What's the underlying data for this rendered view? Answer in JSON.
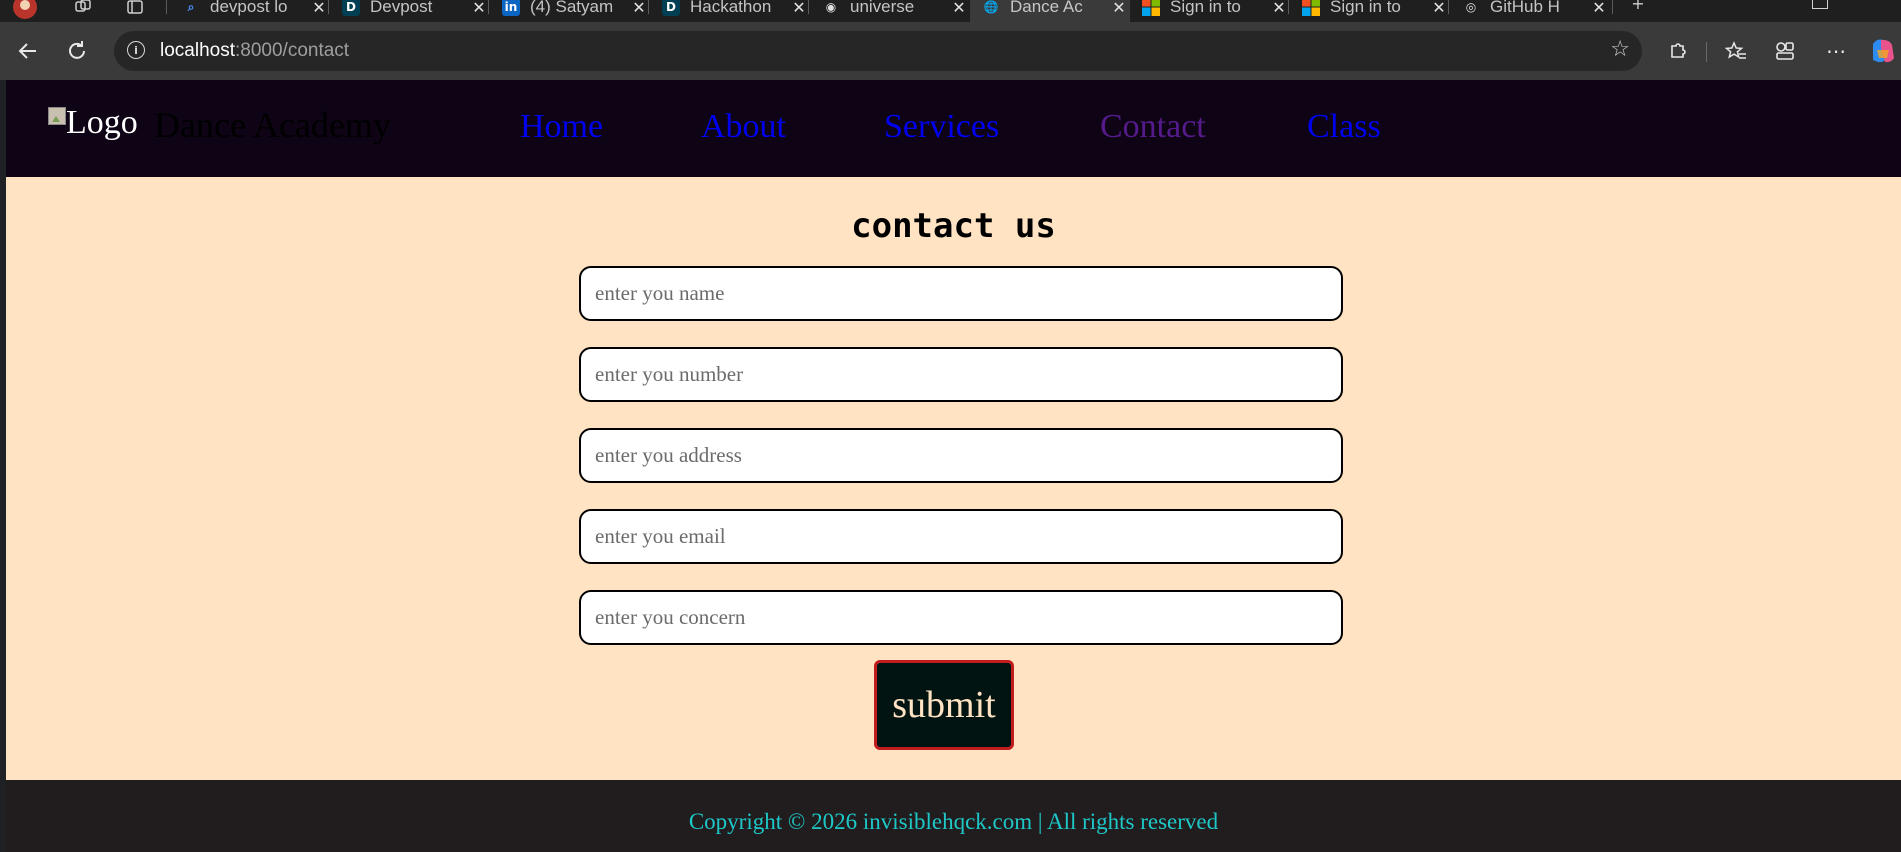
{
  "browser": {
    "tabs": [
      {
        "title": "devpost lo",
        "favicon": "search-icon",
        "color": "#1a73e8",
        "left": false
      },
      {
        "title": "Devpost",
        "favicon": "D",
        "color": "#003e54"
      },
      {
        "title": "(4) Satyam",
        "favicon": "in",
        "color": "#0a66c2"
      },
      {
        "title": "Hackathon",
        "favicon": "D",
        "color": "#003e54"
      },
      {
        "title": "universe",
        "favicon": "github-icon",
        "color": "#333333"
      },
      {
        "title": "Dance Ac",
        "favicon": "globe-icon",
        "color": "#3a3a3a",
        "active": true
      },
      {
        "title": "Sign in to",
        "favicon": "microsoft-icon",
        "color": "#f25022"
      },
      {
        "title": "Sign in to",
        "favicon": "microsoft-icon",
        "color": "#f25022"
      },
      {
        "title": "GitHub H",
        "favicon": "copilot-icon",
        "color": "#555555"
      }
    ],
    "close_glyph": "✕",
    "url_host": "localhost",
    "url_path": ":8000/contact"
  },
  "site": {
    "logo_alt": "Logo",
    "brand": "Dance Academy",
    "nav": {
      "home": "Home",
      "about": "About",
      "services": "Services",
      "contact": "Contact",
      "class": "Class"
    },
    "colors": {
      "nav_link": "#0000ee",
      "nav_visited": "#551a8b",
      "page_bg": "#ffe3c3",
      "footer_text": "#1ec8c8"
    }
  },
  "contact": {
    "title": "contact us",
    "fields": {
      "name": {
        "placeholder": "enter you name",
        "value": ""
      },
      "number": {
        "placeholder": "enter you number",
        "value": ""
      },
      "address": {
        "placeholder": "enter you address",
        "value": ""
      },
      "email": {
        "placeholder": "enter you email",
        "value": ""
      },
      "concern": {
        "placeholder": "enter you concern",
        "value": ""
      }
    },
    "submit_label": "submit"
  },
  "footer": {
    "text": "Copyright © 2026 invisiblehqck.com | All rights reserved"
  }
}
